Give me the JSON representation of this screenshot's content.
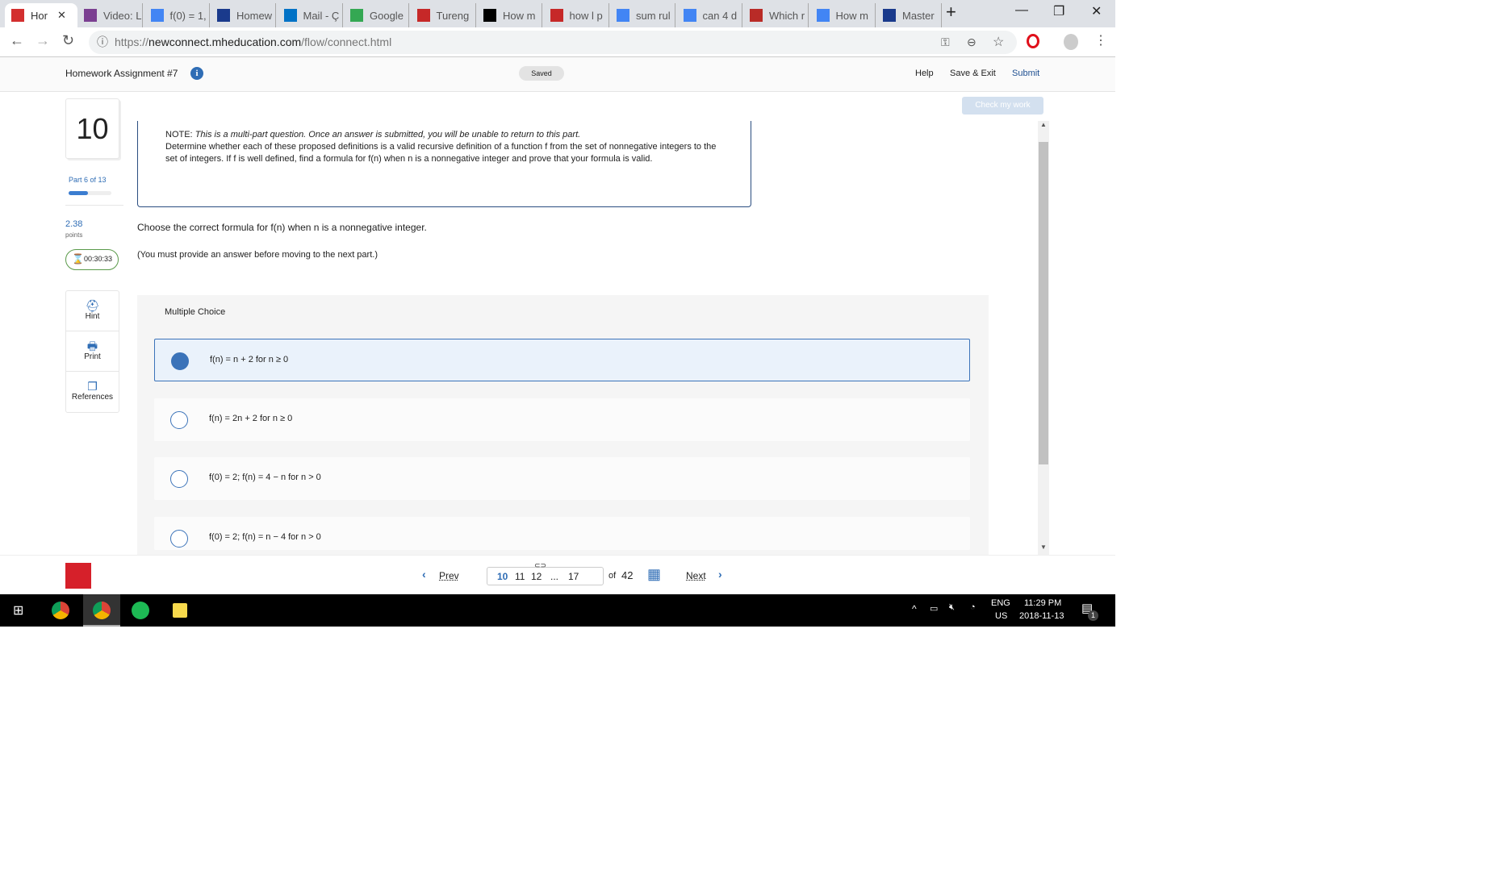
{
  "browser": {
    "tabs": [
      {
        "label": "Hor",
        "icon": "mcgraw-hill-icon",
        "color": "#d32f2f",
        "active": true
      },
      {
        "label": "Video: L",
        "icon": "edx-icon",
        "color": "#7b3f91"
      },
      {
        "label": "f(0) = 1,",
        "icon": "google-icon",
        "color": "#4285f4"
      },
      {
        "label": "Homew",
        "icon": "shield-star-icon",
        "color": "#1a3a8c"
      },
      {
        "label": "Mail - Ç",
        "icon": "outlook-icon",
        "color": "#0072c6"
      },
      {
        "label": "Google",
        "icon": "maps-icon",
        "color": "#34a853"
      },
      {
        "label": "Tureng",
        "icon": "tureng-icon",
        "color": "#c62828"
      },
      {
        "label": "How m",
        "icon": "s-icon",
        "color": "#000000"
      },
      {
        "label": "how l p",
        "icon": "flower-icon",
        "color": "#c62828"
      },
      {
        "label": "sum rul",
        "icon": "google-icon",
        "color": "#4285f4"
      },
      {
        "label": "can 4 d",
        "icon": "google-icon",
        "color": "#4285f4"
      },
      {
        "label": "Which r",
        "icon": "quora-icon",
        "color": "#b92b27"
      },
      {
        "label": "How m",
        "icon": "google-icon",
        "color": "#4285f4"
      },
      {
        "label": "Master",
        "icon": "shield-star-icon",
        "color": "#1a3a8c"
      }
    ],
    "url_prefix": "https://",
    "url_host": "newconnect.mheducation.com",
    "url_path": "/flow/connect.html"
  },
  "header": {
    "title": "Homework Assignment #7",
    "status": "Saved",
    "help": "Help",
    "save_exit": "Save & Exit",
    "submit": "Submit"
  },
  "sidebar": {
    "question_number": "10",
    "part": "Part 6 of 13",
    "part_progress": 0.46,
    "points": "2.38",
    "points_label": "points",
    "timer": "00:30:33",
    "tools": [
      {
        "label": "Hint",
        "icon": "lifebuoy-icon"
      },
      {
        "label": "Print",
        "icon": "printer-icon"
      },
      {
        "label": "References",
        "icon": "copy-icon"
      }
    ]
  },
  "main": {
    "check_button": "Check my work",
    "note_label": "NOTE:",
    "note_italic": "This is a multi-part question. Once an answer is submitted, you will be unable to return to this part.",
    "question": "Determine whether each of these proposed definitions is a valid recursive definition of a function f from the set of nonnegative integers to the set of integers. If f is well defined, find a formula for f(n) when n is a nonnegative integer and prove that your formula is valid.",
    "prompt": "Choose the correct formula for f(n) when n is a nonnegative integer.",
    "instruction": "(You must provide an answer before moving to the next part.)",
    "mc_label": "Multiple Choice",
    "choices": [
      {
        "text": "f(n) = n + 2 for n ≥ 0",
        "selected": true
      },
      {
        "text": "f(n) = 2n + 2 for n ≥ 0",
        "selected": false
      },
      {
        "text": "f(0) = 2; f(n) = 4 − n for n > 0",
        "selected": false
      },
      {
        "text": "f(0) = 2; f(n) = n − 4 for n > 0",
        "selected": false
      }
    ]
  },
  "footer": {
    "logo": "Mc Graw Hill Education",
    "prev": "Prev",
    "pages": [
      "10",
      "11",
      "12",
      "...",
      "17"
    ],
    "current_page": "10",
    "of": "of",
    "total": "42",
    "next": "Next"
  },
  "taskbar": {
    "lang1": "ENG",
    "lang2": "US",
    "time": "11:29 PM",
    "date": "2018-11-13",
    "notifications": "1"
  }
}
